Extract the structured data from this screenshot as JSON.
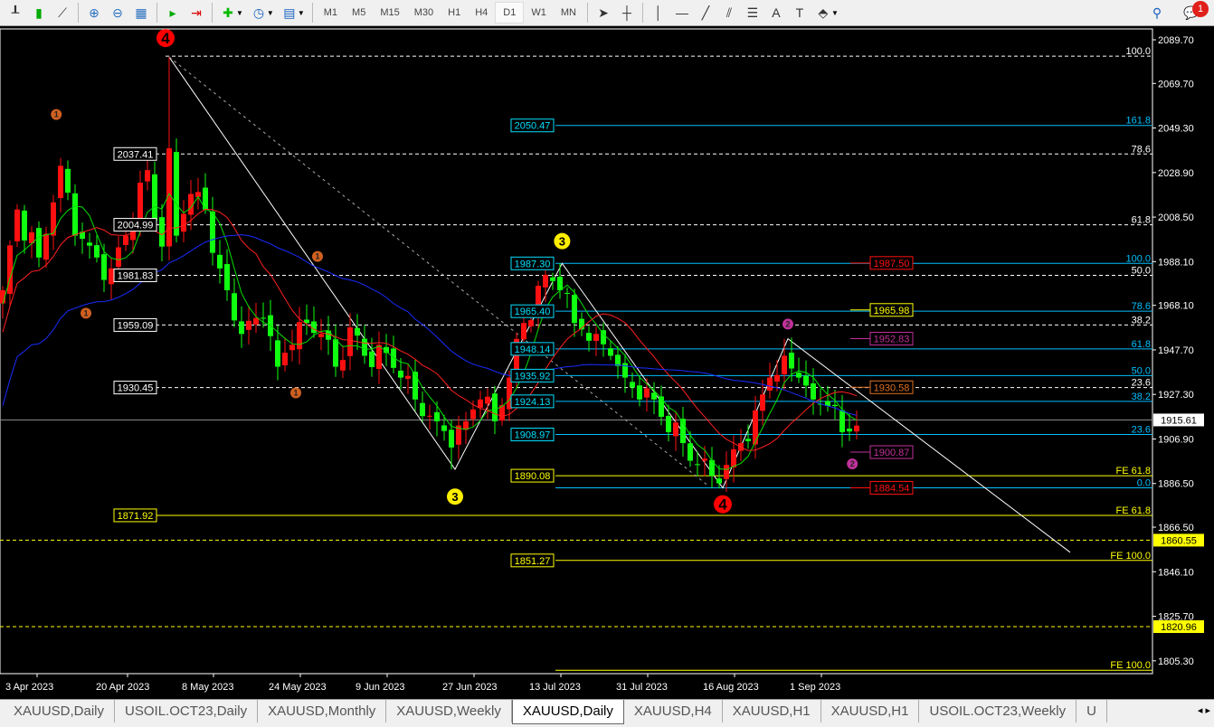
{
  "toolbar": {
    "timeframes": [
      "M1",
      "M5",
      "M15",
      "M30",
      "H1",
      "H4",
      "D1",
      "W1",
      "MN"
    ],
    "active_timeframe": "D1",
    "notification_count": "1"
  },
  "tabs": [
    "XAUUSD,Daily",
    "USOIL.OCT23,Daily",
    "XAUUSD,Monthly",
    "XAUUSD,Weekly",
    "XAUUSD,Daily",
    "XAUUSD,H4",
    "XAUUSD,H1",
    "XAUUSD,H1",
    "USOIL.OCT23,Weekly",
    "U"
  ],
  "active_tab": 4,
  "chart_data": {
    "type": "candlestick",
    "symbol": "XAUUSD",
    "timeframe": "Daily",
    "ylim": [
      1800,
      2093
    ],
    "price_ticks": [
      "2089.70",
      "2069.70",
      "2049.30",
      "2028.90",
      "2008.50",
      "1988.10",
      "1968.10",
      "1947.70",
      "1927.30",
      "1906.90",
      "1886.50",
      "1866.50",
      "1846.10",
      "1825.70",
      "1805.30"
    ],
    "date_ticks": [
      "3 Apr 2023",
      "20 Apr 2023",
      "8 May 2023",
      "24 May 2023",
      "9 Jun 2023",
      "27 Jun 2023",
      "13 Jul 2023",
      "31 Jul 2023",
      "16 Aug 2023",
      "1 Sep 2023"
    ],
    "bar_count": 119,
    "close_pivots": [
      [
        0,
        1975
      ],
      [
        2,
        2012
      ],
      [
        5,
        1990
      ],
      [
        8,
        2032
      ],
      [
        10,
        2000
      ],
      [
        13,
        1990
      ],
      [
        15,
        1985
      ],
      [
        17,
        2000
      ],
      [
        20,
        2030
      ],
      [
        22,
        1995
      ],
      [
        23,
        2040
      ],
      [
        24,
        2000
      ],
      [
        25,
        2010
      ],
      [
        27,
        2020
      ],
      [
        28,
        2012
      ],
      [
        30,
        1985
      ],
      [
        31,
        1975
      ],
      [
        33,
        1955
      ],
      [
        36,
        1962
      ],
      [
        38,
        1940
      ],
      [
        40,
        1950
      ],
      [
        42,
        1960
      ],
      [
        44,
        1955
      ],
      [
        46,
        1940
      ],
      [
        48,
        1958
      ],
      [
        50,
        1945
      ],
      [
        52,
        1950
      ],
      [
        55,
        1935
      ],
      [
        57,
        1925
      ],
      [
        60,
        1915
      ],
      [
        62,
        1903
      ],
      [
        64,
        1915
      ],
      [
        66,
        1925
      ],
      [
        68,
        1915
      ],
      [
        70,
        1935
      ],
      [
        72,
        1960
      ],
      [
        75,
        1982
      ],
      [
        77,
        1975
      ],
      [
        79,
        1960
      ],
      [
        82,
        1955
      ],
      [
        84,
        1945
      ],
      [
        86,
        1935
      ],
      [
        88,
        1925
      ],
      [
        90,
        1925
      ],
      [
        92,
        1910
      ],
      [
        94,
        1905
      ],
      [
        96,
        1895
      ],
      [
        98,
        1890
      ],
      [
        100,
        1895
      ],
      [
        102,
        1905
      ],
      [
        104,
        1920
      ],
      [
        106,
        1935
      ],
      [
        108,
        1945
      ],
      [
        110,
        1935
      ],
      [
        112,
        1925
      ],
      [
        114,
        1922
      ],
      [
        116,
        1910
      ],
      [
        118,
        1913
      ]
    ],
    "extremes": [
      [
        23,
        2081.8
      ],
      [
        62,
        1893.0
      ],
      [
        77,
        1987.3
      ],
      [
        98,
        1884.5
      ],
      [
        108,
        1952.8
      ]
    ],
    "current_price": "1915.61",
    "moving_averages": [
      {
        "color": "#00e000",
        "period": 5
      },
      {
        "color": "#ff2020",
        "period": 13
      },
      {
        "color": "#1a2cff",
        "period": 34
      }
    ],
    "levels": [
      {
        "price": 2082.2,
        "color": "#ffffff",
        "dash": true,
        "from": "peak",
        "fib": "100.0"
      },
      {
        "price": 2050.47,
        "color": "#00c0ff",
        "from": "mid",
        "box": "2050.47",
        "fib": "161.8"
      },
      {
        "price": 2037.41,
        "color": "#ffffff",
        "dash": true,
        "from": "left",
        "box": "2037.41",
        "fib": "78.6"
      },
      {
        "price": 2004.99,
        "color": "#ffffff",
        "dash": true,
        "from": "left",
        "box": "2004.99",
        "fib": "61.8"
      },
      {
        "price": 1987.3,
        "color": "#00c0ff",
        "from": "mid",
        "box": "1987.30",
        "fib": "100.0"
      },
      {
        "price": 1981.83,
        "color": "#ffffff",
        "dash": true,
        "from": "left",
        "box": "1981.83",
        "fib": "50.0"
      },
      {
        "price": 1965.4,
        "color": "#00c0ff",
        "from": "mid",
        "box": "1965.40",
        "fib": "78.6"
      },
      {
        "price": 1959.09,
        "color": "#ffffff",
        "dash": true,
        "from": "left",
        "box": "1959.09",
        "fib": "38.2"
      },
      {
        "price": 1948.14,
        "color": "#00c0ff",
        "from": "mid",
        "box": "1948.14",
        "fib": "61.8"
      },
      {
        "price": 1935.92,
        "color": "#00c0ff",
        "from": "mid",
        "box": "1935.92",
        "fib": "50.0"
      },
      {
        "price": 1930.45,
        "color": "#ffffff",
        "dash": true,
        "from": "left",
        "box": "1930.45",
        "fib": "23.6"
      },
      {
        "price": 1924.13,
        "color": "#00c0ff",
        "from": "mid",
        "box": "1924.13",
        "fib": "38.2"
      },
      {
        "price": 1908.97,
        "color": "#00c0ff",
        "from": "mid",
        "box": "1908.97",
        "fib": "23.6"
      },
      {
        "price": 1890.08,
        "color": "#ffff00",
        "from": "mid",
        "box": "1890.08",
        "fib": "FE 61.8"
      },
      {
        "price": 1884.54,
        "color": "#00c0ff",
        "from": "mid",
        "fib": "0.0"
      },
      {
        "price": 1871.92,
        "color": "#ffff00",
        "from": "left",
        "box": "1871.92",
        "fib": "FE 61.8"
      },
      {
        "price": 1860.55,
        "color": "#ffff00",
        "dash": true,
        "from": "all",
        "axis": "1860.55"
      },
      {
        "price": 1851.27,
        "color": "#ffff00",
        "from": "mid",
        "box": "1851.27",
        "fib": "FE 100.0"
      },
      {
        "price": 1820.96,
        "color": "#ffff00",
        "dash": true,
        "from": "all",
        "axis": "1820.96"
      },
      {
        "price": 1801.0,
        "color": "#ffff00",
        "from": "mid",
        "fib": "FE 100.0"
      }
    ],
    "right_boxes": [
      {
        "price": 1987.5,
        "text": "1987.50",
        "color": "#ff1010"
      },
      {
        "price": 1965.98,
        "text": "1965.98",
        "color": "#ffff00"
      },
      {
        "price": 1952.83,
        "text": "1952.83",
        "color": "#c0309a"
      },
      {
        "price": 1930.58,
        "text": "1930.58",
        "color": "#e07020"
      },
      {
        "price": 1900.87,
        "text": "1900.87",
        "color": "#c0309a"
      },
      {
        "price": 1884.54,
        "text": "1884.54",
        "color": "#ff1010"
      }
    ],
    "wave_labels": [
      {
        "text": "4",
        "color": "#ff0000",
        "bar": 22.5,
        "price": 2090.5,
        "big": true
      },
      {
        "text": "4",
        "color": "#ff0000",
        "bar": 99.5,
        "price": 1877,
        "big": true
      },
      {
        "text": "3",
        "color": "#ffee00",
        "bar": 77.3,
        "price": 1997.5
      },
      {
        "text": "3",
        "color": "#ffee00",
        "bar": 62.5,
        "price": 1880.5
      },
      {
        "text": "1",
        "color": "#d06020",
        "bar": 7.4,
        "price": 2055.5
      },
      {
        "text": "1",
        "color": "#d06020",
        "bar": 11.5,
        "price": 1964.5
      },
      {
        "text": "1",
        "color": "#d06020",
        "bar": 43.5,
        "price": 1990.5
      },
      {
        "text": "1",
        "color": "#d06020",
        "bar": 40.5,
        "price": 1928
      },
      {
        "text": "2",
        "color": "#c0309a",
        "bar": 108.5,
        "price": 1959.5
      },
      {
        "text": "2",
        "color": "#c0309a",
        "bar": 117.4,
        "price": 1895.5
      }
    ],
    "zigzag": [
      [
        23,
        2081.8
      ],
      [
        62.5,
        1893.0
      ],
      [
        77.3,
        1987.3
      ],
      [
        99.5,
        1884.5
      ],
      [
        108.5,
        1952.8
      ],
      [
        147.5,
        1855.0
      ]
    ],
    "channel": [
      [
        23,
        2081.8
      ],
      [
        97.3,
        1886.0
      ]
    ]
  }
}
